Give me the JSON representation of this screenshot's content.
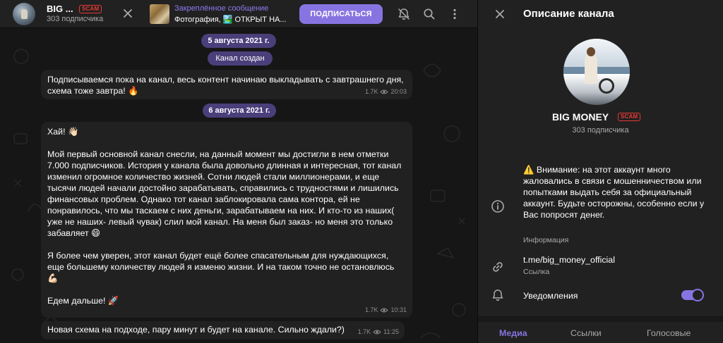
{
  "header": {
    "title": "BIG ...",
    "scam_badge": "SCAM",
    "subscribers": "303 подписчика",
    "pinned_label": "Закреплённое сообщение",
    "pinned_text": "Фотография, 🏞️ ОТКРЫТ НА...",
    "subscribe_button": "ПОДПИСАТЬСЯ"
  },
  "chat": {
    "date1": "5 августа 2021 г.",
    "service1": "Канал создан",
    "messages": [
      {
        "text": "Подписываемся пока на канал, весь контент начинаю выкладывать с завтрашнего дня, схема тоже завтра! 🔥",
        "views": "1.7K",
        "time": "20:03"
      },
      {
        "text": "Хай! 👋🏻\n\nМой первый основной канал снесли, на данный момент мы достигли в нем отметки 7.000 подписчиков. История у канала была довольно длинная и интересная, тот канал изменил огромное количество жизней. Сотни людей стали миллионерами, и еще тысячи людей начали достойно зарабатывать, справились с трудностями и лишились финансовых проблем. Однако тот канал заблокировала сама контора, ей не понравилось, что мы таскаем с них деньги, зарабатываем на них. И кто-то из наших( уже не наших- левый чувак) слил мой канал. На меня был заказ- но меня это только забавляет 😄\n\nЯ более чем уверен, этот канал будет ещё более спасательным для нуждающихся, еще большему количеству людей я изменю жизни. И на таком точно не остановлюсь 💪🏻\n\nЕдем дальше! 🚀",
        "views": "1.7K",
        "time": "10:31"
      },
      {
        "text": "Новая схема на подходе, пару минут и будет на канале. Сильно ждали?)",
        "views": "1.7K",
        "time": "11:25"
      }
    ],
    "date2": "6 августа 2021 г."
  },
  "panel": {
    "title": "Описание канала",
    "name": "BIG MONEY",
    "scam_badge": "SCAM",
    "subscribers": "303 подписчика",
    "warning": "⚠️ Внимание: на этот аккаунт много жаловались в связи с мошенничеством или попытками выдать себя за официальный аккаунт. Будьте осторожны, особенно если у Вас попросят денег.",
    "info_label": "Информация",
    "link": "t.me/big_money_official",
    "link_label": "Ссылка",
    "notifications_label": "Уведомления",
    "notifications_enabled": true,
    "tabs": [
      "Медиа",
      "Ссылки",
      "Голосовые"
    ],
    "active_tab": "Медиа"
  },
  "colors": {
    "accent": "#8774e1",
    "scam": "#e53935",
    "background": "#0f0f0f",
    "surface": "#212121"
  }
}
